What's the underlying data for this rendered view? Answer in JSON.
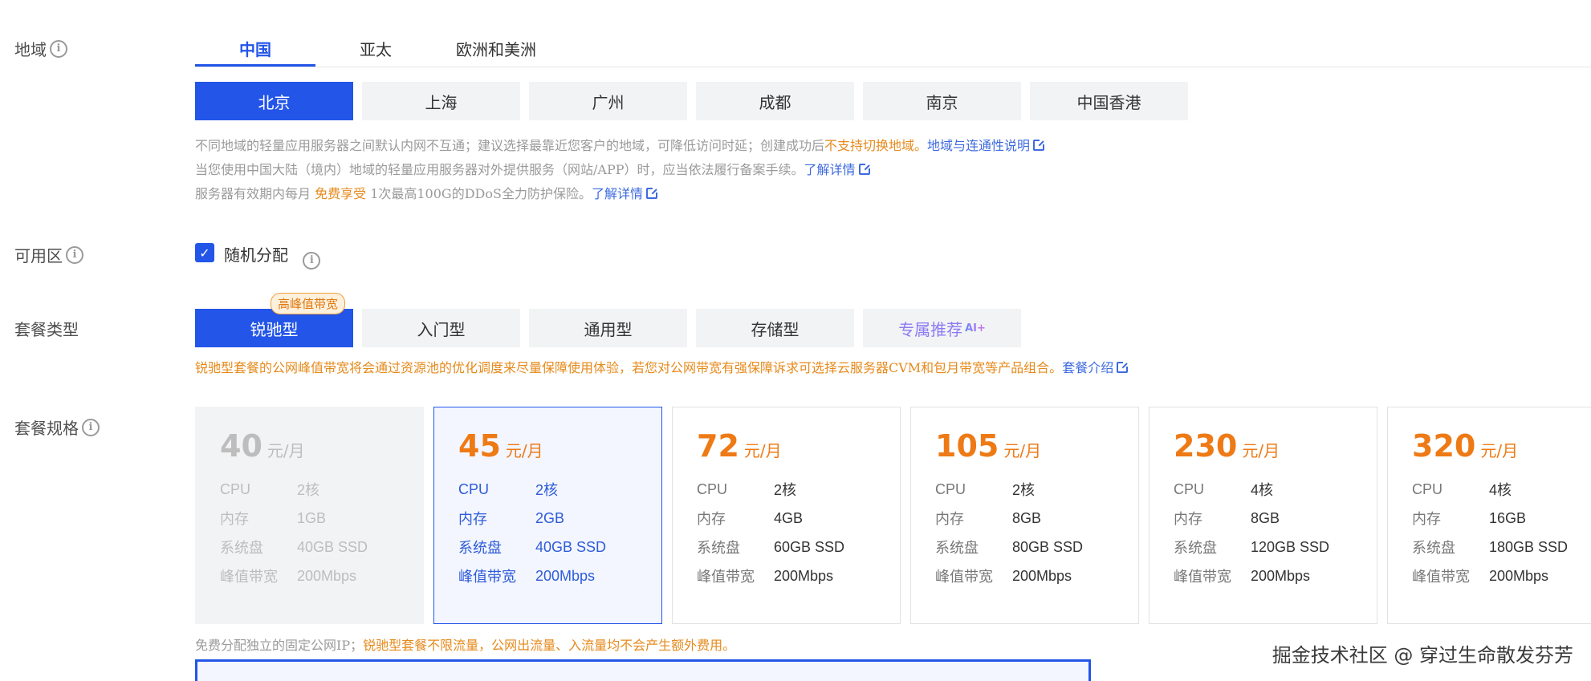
{
  "region": {
    "label": "地域",
    "tabs": [
      "中国",
      "亚太",
      "欧洲和美洲"
    ],
    "cities": [
      "北京",
      "上海",
      "广州",
      "成都",
      "南京",
      "中国香港"
    ],
    "notes": {
      "line1_a": "不同地域的轻量应用服务器之间默认内网不互通；建议选择最靠近您客户的地域，可降低访问时延；创建成功后",
      "line1_orange": "不支持切换地域",
      "line1_b": "。",
      "line1_link": "地域与连通性说明",
      "line2_a": "当您使用中国大陆（境内）地域的轻量应用服务器对外提供服务（网站/APP）时，应当依法履行备案手续。",
      "line2_link": "了解详情",
      "line3_a": "服务器有效期内每月 ",
      "line3_orange": "免费享受",
      "line3_b": " 1次最高100G的DDoS全力防护保险。",
      "line3_link": "了解详情"
    }
  },
  "zone": {
    "label": "可用区",
    "checkbox_label": "随机分配"
  },
  "package_type": {
    "label": "套餐类型",
    "badge": "高峰值带宽",
    "options": [
      "锐驰型",
      "入门型",
      "通用型",
      "存储型",
      "专属推荐"
    ],
    "ai_tag": "AI+",
    "note_orange": "锐驰型套餐的公网峰值带宽将会通过资源池的优化调度来尽量保障使用体验，若您对公网带宽有强保障诉求可选择云服务器CVM和包月带宽等产品组合。",
    "note_link": "套餐介绍"
  },
  "package_spec": {
    "label": "套餐规格",
    "unit": "元/月",
    "keys": [
      "CPU",
      "内存",
      "系统盘",
      "峰值带宽"
    ],
    "cards": [
      {
        "price": "40",
        "specs": [
          "2核",
          "1GB",
          "40GB SSD",
          "200Mbps"
        ]
      },
      {
        "price": "45",
        "specs": [
          "2核",
          "2GB",
          "40GB SSD",
          "200Mbps"
        ]
      },
      {
        "price": "72",
        "specs": [
          "2核",
          "4GB",
          "60GB SSD",
          "200Mbps"
        ]
      },
      {
        "price": "105",
        "specs": [
          "2核",
          "8GB",
          "80GB SSD",
          "200Mbps"
        ]
      },
      {
        "price": "230",
        "specs": [
          "4核",
          "8GB",
          "120GB SSD",
          "200Mbps"
        ]
      },
      {
        "price": "320",
        "specs": [
          "4核",
          "16GB",
          "180GB SSD",
          "200Mbps"
        ]
      }
    ],
    "footer_gray": "免费分配独立的固定公网IP；",
    "footer_orange": "锐驰型套餐不限流量，公网出流量、入流量均不会产生额外费用。"
  },
  "bottom_box_text": "",
  "watermark": "掘金技术社区 @ 穿过生命散发芬芳",
  "colors": {
    "primary": "#2255e8",
    "orange": "#ee7a16",
    "link": "#3d6adf"
  }
}
